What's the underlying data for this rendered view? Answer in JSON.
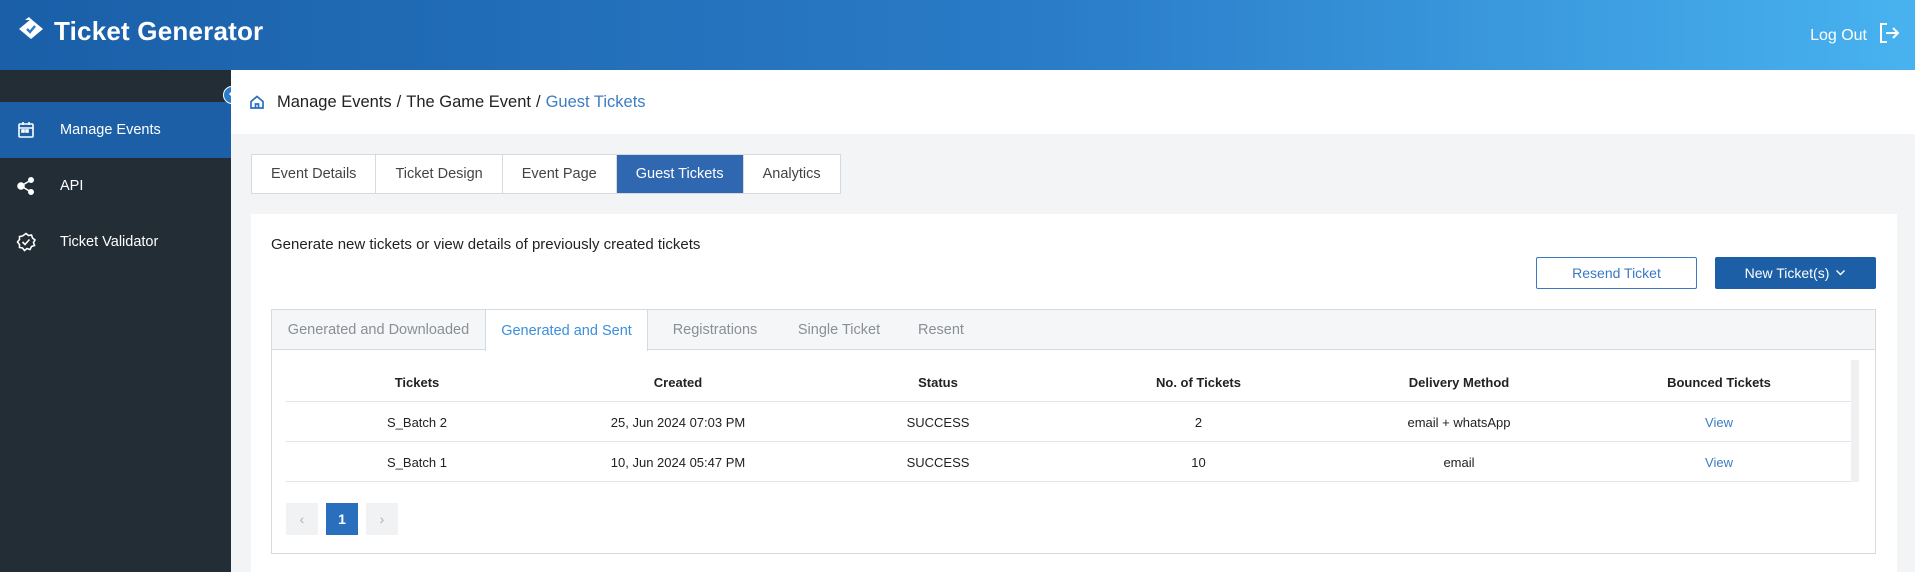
{
  "app": {
    "title": "Ticket Generator",
    "logout_label": "Log Out"
  },
  "sidebar": {
    "items": [
      {
        "label": "Manage Events",
        "icon": "calendar-icon",
        "active": true
      },
      {
        "label": "API",
        "icon": "share-nodes-icon",
        "active": false
      },
      {
        "label": "Ticket Validator",
        "icon": "badge-check-icon",
        "active": false
      }
    ]
  },
  "breadcrumb": {
    "items": [
      "Manage Events",
      "The Game Event",
      "Guest Tickets"
    ],
    "separator": "/"
  },
  "tabs": [
    "Event Details",
    "Ticket Design",
    "Event Page",
    "Guest Tickets",
    "Analytics"
  ],
  "active_tab": "Guest Tickets",
  "panel": {
    "description": "Generate new tickets or view details of previously created tickets",
    "resend_label": "Resend Ticket",
    "new_label": "New Ticket(s)"
  },
  "subtabs": [
    "Generated and Downloaded",
    "Generated and Sent",
    "Registrations",
    "Single Ticket",
    "Resent"
  ],
  "active_subtab": "Generated and Sent",
  "table": {
    "headers": [
      "Tickets",
      "Created",
      "Status",
      "No. of Tickets",
      "Delivery Method",
      "Bounced Tickets"
    ],
    "rows": [
      [
        "S_Batch 2",
        "25, Jun 2024 07:03 PM",
        "SUCCESS",
        "2",
        "email + whatsApp",
        "View"
      ],
      [
        "S_Batch 1",
        "10, Jun 2024 05:47 PM",
        "SUCCESS",
        "10",
        "email",
        "View"
      ]
    ]
  },
  "pagination": {
    "prev": "‹",
    "current_page": "1",
    "next": "›"
  },
  "colors": {
    "primary": "#1c5fa6",
    "sidebar_bg": "#222d35",
    "link": "#3b7dc4",
    "header_gradient_end": "#48b2ef"
  }
}
